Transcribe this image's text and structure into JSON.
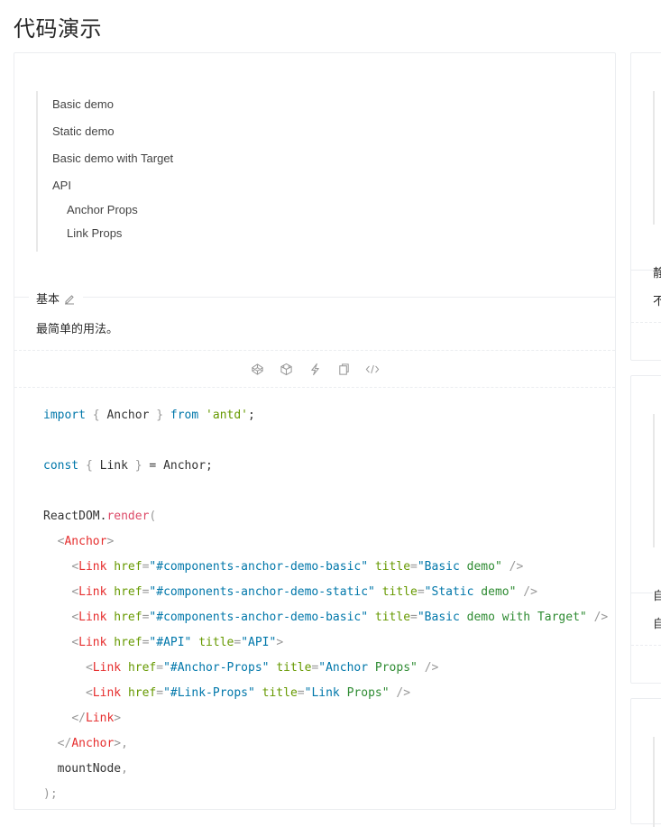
{
  "page": {
    "title": "代码演示"
  },
  "demo": {
    "anchor_links": [
      {
        "label": "Basic demo",
        "level": 1
      },
      {
        "label": "Static demo",
        "level": 1
      },
      {
        "label": "Basic demo with Target",
        "level": 1
      },
      {
        "label": "API",
        "level": 1
      },
      {
        "label": "Anchor Props",
        "level": 2
      },
      {
        "label": "Link Props",
        "level": 2
      }
    ],
    "meta_title": "基本",
    "meta_description": "最简单的用法。",
    "actions": [
      "codepen-icon",
      "codesandbox-icon",
      "riddle-icon",
      "copy-icon",
      "expand-code-icon"
    ],
    "code_lines": [
      "import { Anchor } from 'antd';",
      "",
      "const { Link } = Anchor;",
      "",
      "ReactDOM.render(",
      "  <Anchor>",
      "    <Link href=\"#components-anchor-demo-basic\" title=\"Basic demo\" />",
      "    <Link href=\"#components-anchor-demo-static\" title=\"Static demo\" />",
      "    <Link href=\"#components-anchor-demo-basic\" title=\"Basic demo with Target\" />",
      "    <Link href=\"#API\" title=\"API\">",
      "      <Link href=\"#Anchor-Props\" title=\"Anchor Props\" />",
      "      <Link href=\"#Link-Props\" title=\"Link Props\" />",
      "    </Link>",
      "  </Anchor>,",
      "  mountNode,",
      ");"
    ]
  },
  "side_cards": [
    {
      "meta_title_partial": "静",
      "meta_desc_partial": "不"
    },
    {
      "meta_title_partial": "自",
      "meta_desc_partial": "自"
    },
    {
      "meta_title_partial": "",
      "meta_desc_partial": ""
    }
  ]
}
